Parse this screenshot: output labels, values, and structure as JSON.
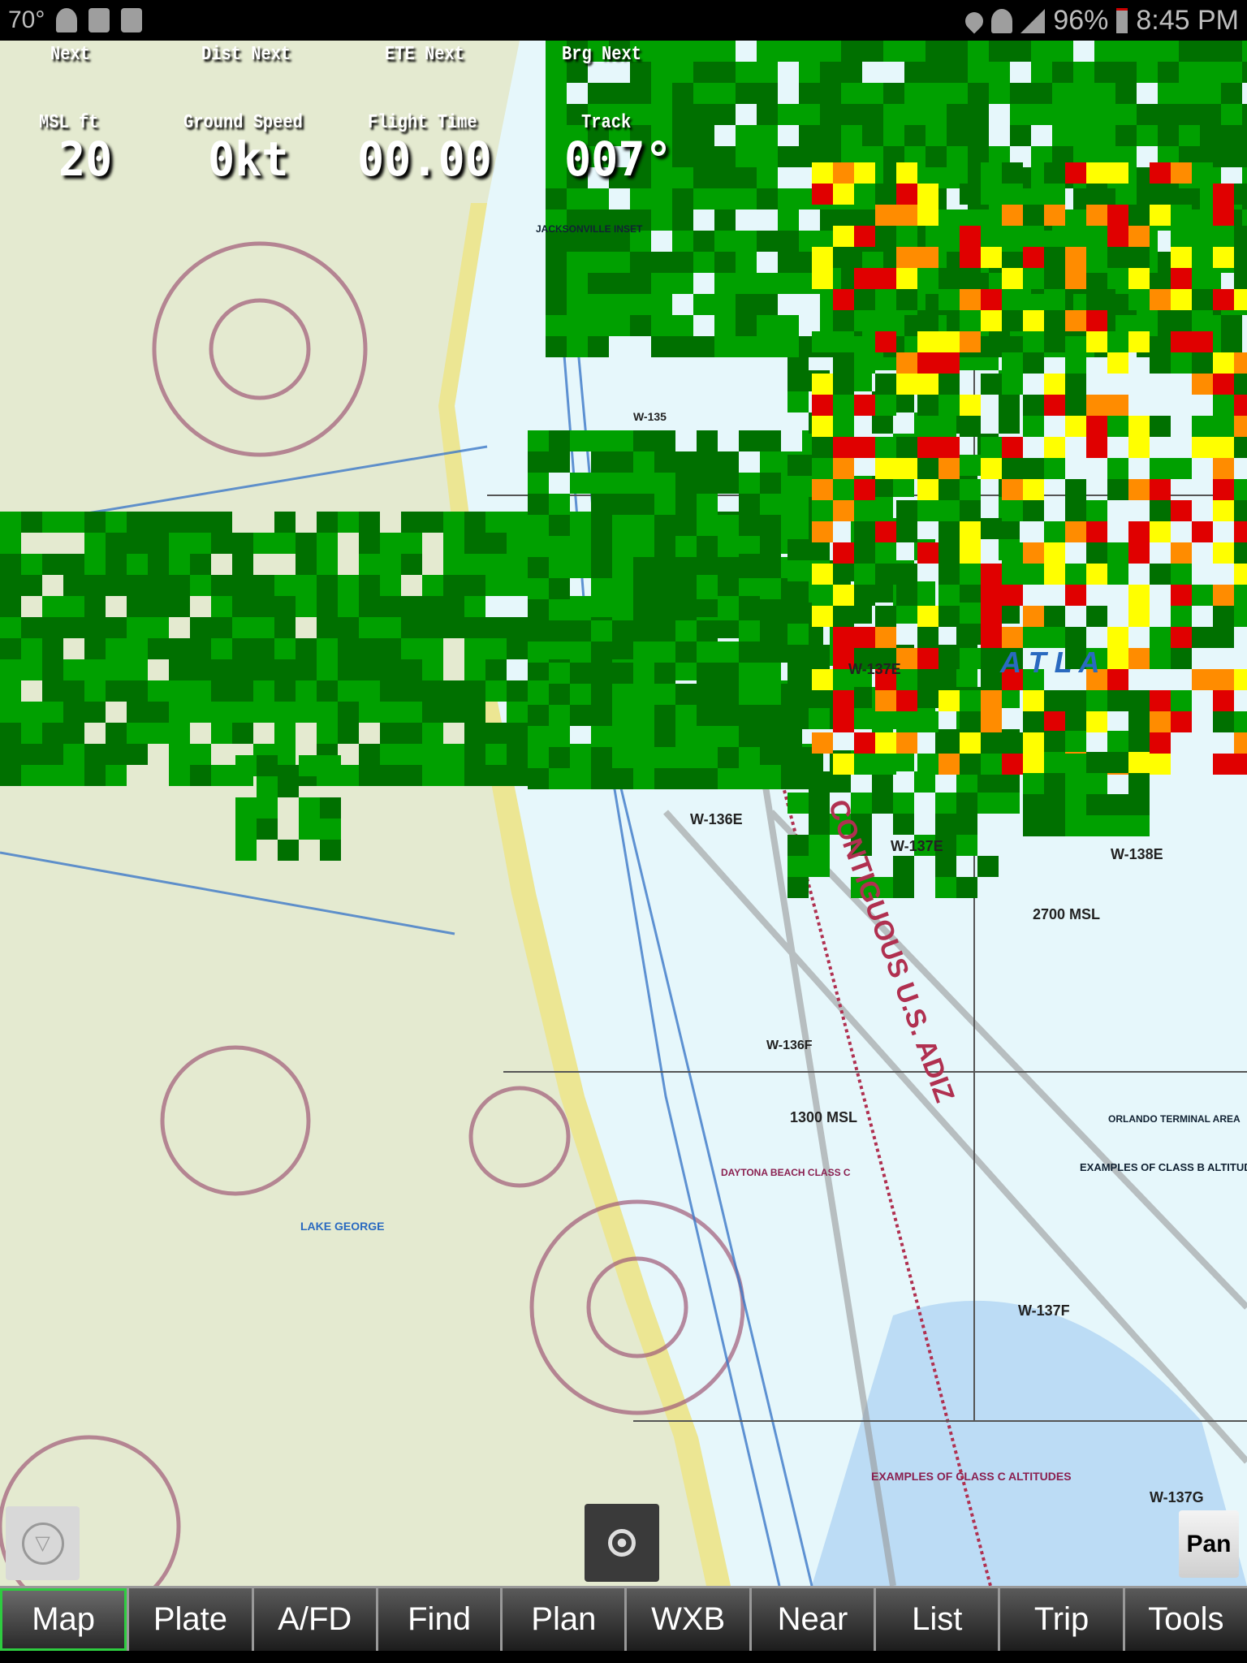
{
  "status_bar": {
    "temperature": "70°",
    "battery": "96%",
    "time": "8:45 PM",
    "left_icons": [
      "wifi-icon",
      "sim-icon",
      "clipboard-icon"
    ],
    "right_icons": [
      "location-icon",
      "wifi-signal-icon",
      "cell-signal-icon",
      "battery-icon"
    ]
  },
  "info_panel": {
    "row1": [
      {
        "label": "Next",
        "value": ""
      },
      {
        "label": "Dist Next",
        "value": ""
      },
      {
        "label": "ETE Next",
        "value": ""
      },
      {
        "label": "Brg Next",
        "value": ""
      }
    ],
    "row2": [
      {
        "label": "MSL ft",
        "value": "20"
      },
      {
        "label": "Ground Speed",
        "value": "0kt"
      },
      {
        "label": "Flight Time",
        "value": "00.00"
      },
      {
        "label": "Track",
        "value": "007°"
      }
    ]
  },
  "map": {
    "labels": {
      "adiz": "CONTIGUOUS U.S. ADIZ",
      "w137e": "W-137E",
      "w136e": "W-136E",
      "w137e2": "W-137E",
      "w138e": "W-138E",
      "w136f": "W-136F",
      "w137f": "W-137F",
      "w137g": "W-137G",
      "msl2700": "2700 MSL",
      "msl1300": "1300 MSL",
      "atlantic": "A T L A",
      "jacksonville_inset": "JACKSONVILLE INSET",
      "orlando_terminal": "ORLANDO TERMINAL AREA",
      "class_b_examples": "EXAMPLES OF CLASS B ALTITUDES",
      "class_c_examples": "EXAMPLES OF CLASS C ALTITUDES",
      "lake_george": "LAKE GEORGE",
      "daytona": "DAYTONA BEACH CLASS C",
      "w135": "W-135"
    },
    "colors": {
      "land": "#e4ead0",
      "water": "#e6f7fb",
      "radar_light": "#00a000",
      "radar_dark": "#007000",
      "radar_yellow": "#ffff00",
      "radar_orange": "#ff8c00",
      "radar_red": "#e00000"
    }
  },
  "map_buttons": {
    "pan_label": "Pan"
  },
  "tabs": [
    {
      "label": "Map",
      "active": true
    },
    {
      "label": "Plate"
    },
    {
      "label": "A/FD"
    },
    {
      "label": "Find"
    },
    {
      "label": "Plan"
    },
    {
      "label": "WXB"
    },
    {
      "label": "Near"
    },
    {
      "label": "List"
    },
    {
      "label": "Trip"
    },
    {
      "label": "Tools"
    }
  ]
}
